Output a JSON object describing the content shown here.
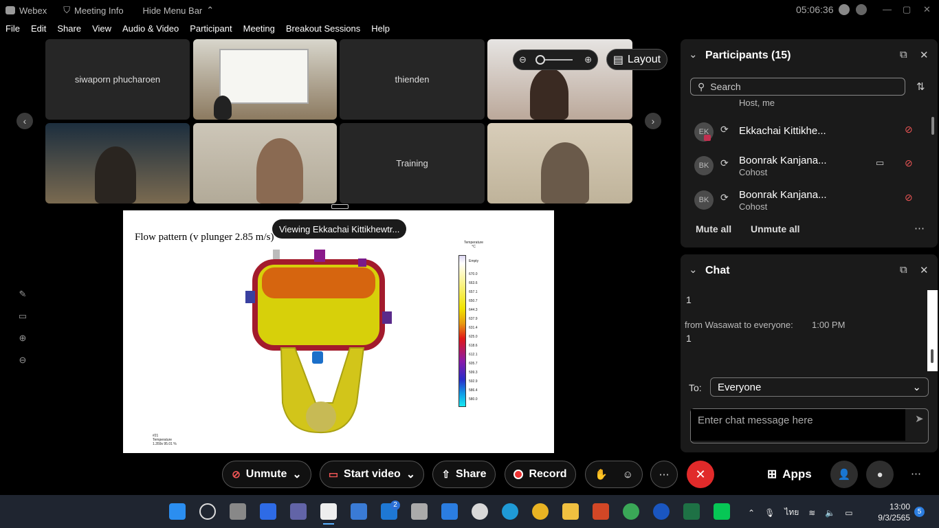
{
  "window": {
    "app_name": "Webex",
    "meeting_info": "Meeting Info",
    "hide_menu": "Hide Menu Bar",
    "time": "05:06:36"
  },
  "menu": [
    "File",
    "Edit",
    "Share",
    "View",
    "Audio & Video",
    "Participant",
    "Meeting",
    "Breakout Sessions",
    "Help"
  ],
  "tiles": [
    {
      "name": "siwaporn phucharoen"
    },
    {
      "name": "thienden"
    },
    {
      "name": "Training"
    }
  ],
  "layout_button": "Layout",
  "share": {
    "viewing": "Viewing Ekkachai Kittikhewtr...",
    "title": "Flow pattern (v plunger 2.85 m/s)",
    "legend_title": "Temperature\n°C",
    "legend_values": [
      "Empty",
      "670.0",
      "663.6",
      "657.1",
      "650.7",
      "644.3",
      "637.9",
      "631.4",
      "625.0",
      "618.6",
      "612.1",
      "605.7",
      "599.3",
      "592.9",
      "586.4",
      "580.0"
    ],
    "footer": "#21\nTemperature\n1.359s 95.01 %"
  },
  "participants": {
    "title": "Participants (15)",
    "search_placeholder": "Search",
    "partial_role": "Host, me",
    "rows": [
      {
        "initials": "EK",
        "name": "Ekkachai Kittikhe...",
        "role": ""
      },
      {
        "initials": "BK",
        "name": "Boonrak Kanjana...",
        "role": "Cohost"
      },
      {
        "initials": "BK",
        "name": "Boonrak Kanjana...",
        "role": "Cohost"
      }
    ],
    "mute_all": "Mute all",
    "unmute_all": "Unmute all"
  },
  "chat": {
    "title": "Chat",
    "msg1": "1",
    "sender_line": "from Wasawat to everyone:",
    "sender_time": "1:00 PM",
    "msg2": "1",
    "to_label": "To:",
    "to_value": "Everyone",
    "input_placeholder": "Enter chat message here"
  },
  "controls": {
    "unmute": "Unmute",
    "start_video": "Start video",
    "share": "Share",
    "record": "Record",
    "apps": "Apps"
  },
  "taskbar": {
    "lang": "ไทย",
    "time": "13:00",
    "date": "9/3/2565",
    "notif_count": "5",
    "mail_badge": "2"
  },
  "colors": {
    "end_call": "#e12a2a",
    "panel_bg": "#1a1a1a",
    "taskbar_bg": "#1f2530",
    "mute_red": "#e55555"
  }
}
